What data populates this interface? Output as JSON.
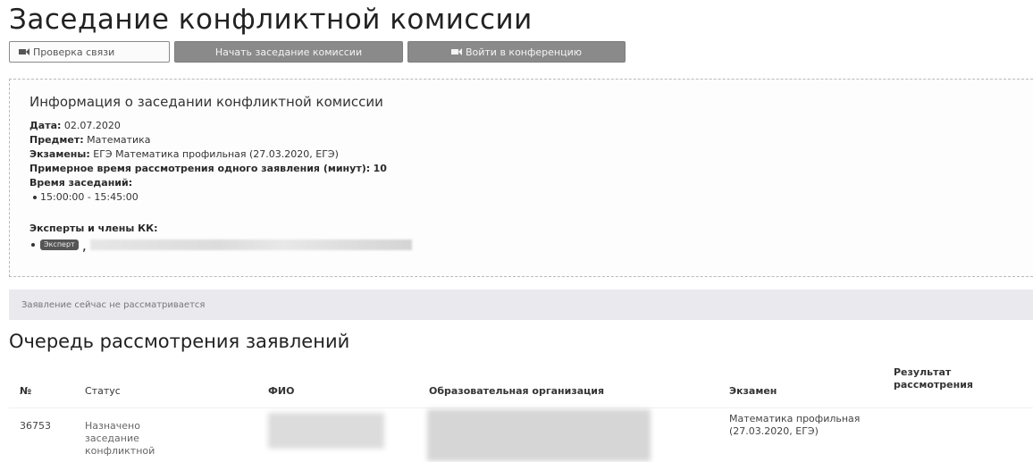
{
  "page": {
    "title": "Заседание конфликтной комиссии"
  },
  "toolbar": {
    "check_connection_label": "Проверка связи",
    "start_meeting_label": "Начать заседание комиссии",
    "join_conference_label": "Войти в конференцию",
    "icon": "video-camera-icon"
  },
  "info": {
    "heading": "Информация о заседании конфликтной комиссии",
    "date_label": "Дата:",
    "date_value": "02.07.2020",
    "subject_label": "Предмет:",
    "subject_value": "Математика",
    "exams_label": "Экзамены:",
    "exams_value": "ЕГЭ Математика профильная (27.03.2020, ЕГЭ)",
    "approx_time_label": "Примерное время рассмотрения одного заявления (минут):",
    "approx_time_value": "10",
    "sessions_label": "Время заседаний:",
    "sessions": [
      "15:00:00 - 15:45:00"
    ],
    "experts_label": "Эксперты и члены КК:",
    "expert_badge": "Эксперт",
    "expert_separator": ","
  },
  "status_bar": {
    "text": "Заявление сейчас не рассматривается"
  },
  "queue": {
    "title": "Очередь рассмотрения заявлений",
    "columns": {
      "num": "№",
      "status": "Статус",
      "fio": "ФИО",
      "org": "Образовательная организация",
      "exam": "Экзамен",
      "result": "Результат рассмотрения"
    },
    "rows": [
      {
        "num": "36753",
        "status": "Назначено заседание конфликтной",
        "exam": "Математика профильная (27.03.2020, ЕГЭ)",
        "result": ""
      }
    ]
  },
  "colors": {
    "dark_button": "#8a8a8a",
    "status_bar_bg": "#e9e9ee"
  }
}
